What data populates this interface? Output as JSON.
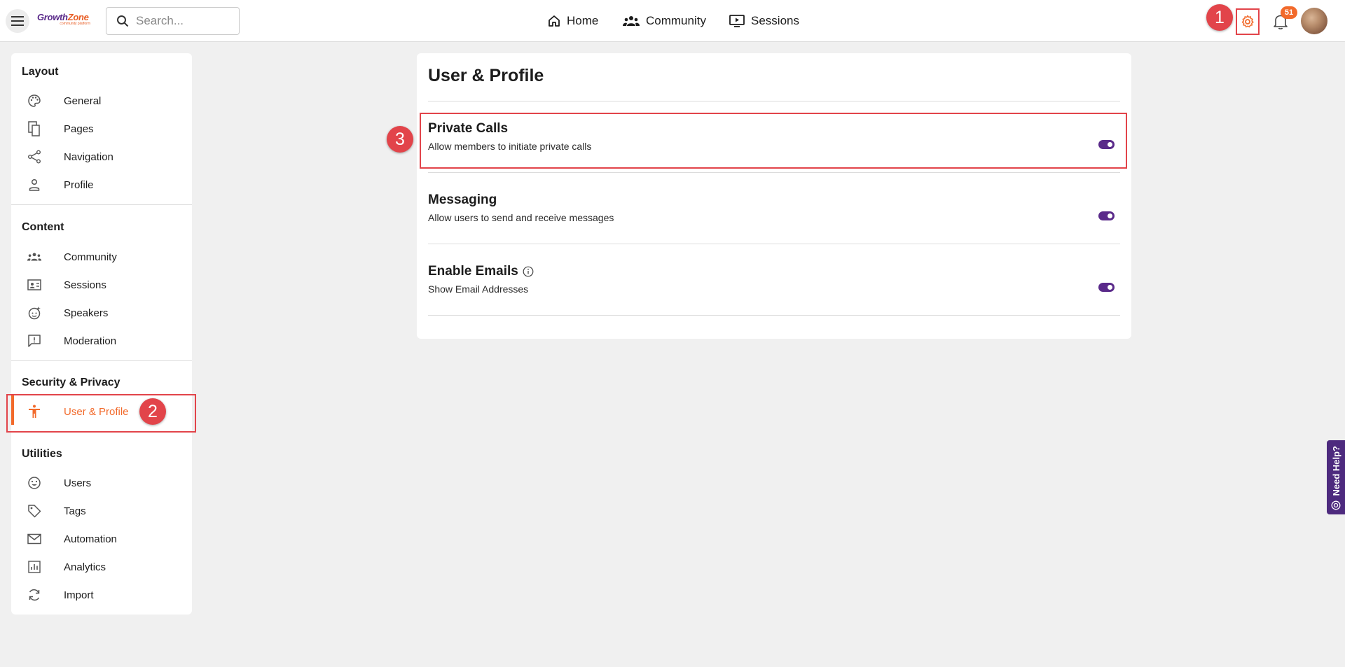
{
  "header": {
    "logo": {
      "main": "GrowthZone",
      "sub": "community platform"
    },
    "search": {
      "placeholder": "Search..."
    },
    "nav": [
      {
        "label": "Home",
        "icon": "home-icon"
      },
      {
        "label": "Community",
        "icon": "people-icon"
      },
      {
        "label": "Sessions",
        "icon": "screen-play-icon"
      }
    ],
    "notifications_count": "51"
  },
  "annotations": {
    "step1": "1",
    "step2": "2",
    "step3": "3"
  },
  "sidebar": {
    "sections": [
      {
        "title": "Layout",
        "items": [
          {
            "label": "General",
            "icon": "palette-icon"
          },
          {
            "label": "Pages",
            "icon": "pages-icon"
          },
          {
            "label": "Navigation",
            "icon": "share-icon"
          },
          {
            "label": "Profile",
            "icon": "person-icon"
          }
        ]
      },
      {
        "title": "Content",
        "items": [
          {
            "label": "Community",
            "icon": "people-icon"
          },
          {
            "label": "Sessions",
            "icon": "contact-card-icon"
          },
          {
            "label": "Speakers",
            "icon": "face-icon"
          },
          {
            "label": "Moderation",
            "icon": "report-icon"
          }
        ]
      },
      {
        "title": "Security & Privacy",
        "items": [
          {
            "label": "User & Profile",
            "icon": "accessibility-icon",
            "active": true
          }
        ]
      },
      {
        "title": "Utilities",
        "items": [
          {
            "label": "Users",
            "icon": "face-icon"
          },
          {
            "label": "Tags",
            "icon": "tag-icon"
          },
          {
            "label": "Automation",
            "icon": "mail-icon"
          },
          {
            "label": "Analytics",
            "icon": "analytics-icon"
          },
          {
            "label": "Import",
            "icon": "sync-icon"
          }
        ]
      }
    ]
  },
  "main": {
    "title": "User & Profile",
    "settings": [
      {
        "title": "Private Calls",
        "description": "Allow members to initiate private calls",
        "enabled": true
      },
      {
        "title": "Messaging",
        "description": "Allow users to send and receive messages",
        "enabled": true
      },
      {
        "title": "Enable Emails",
        "description": "Show Email Addresses",
        "enabled": true,
        "info_icon": true
      }
    ]
  },
  "help_tab": {
    "label": "Need Help?"
  },
  "colors": {
    "accent": "#f26a2b",
    "toggle": "#5a2a8a",
    "annotation": "#e2444a",
    "help_tab": "#4d2a7e"
  }
}
